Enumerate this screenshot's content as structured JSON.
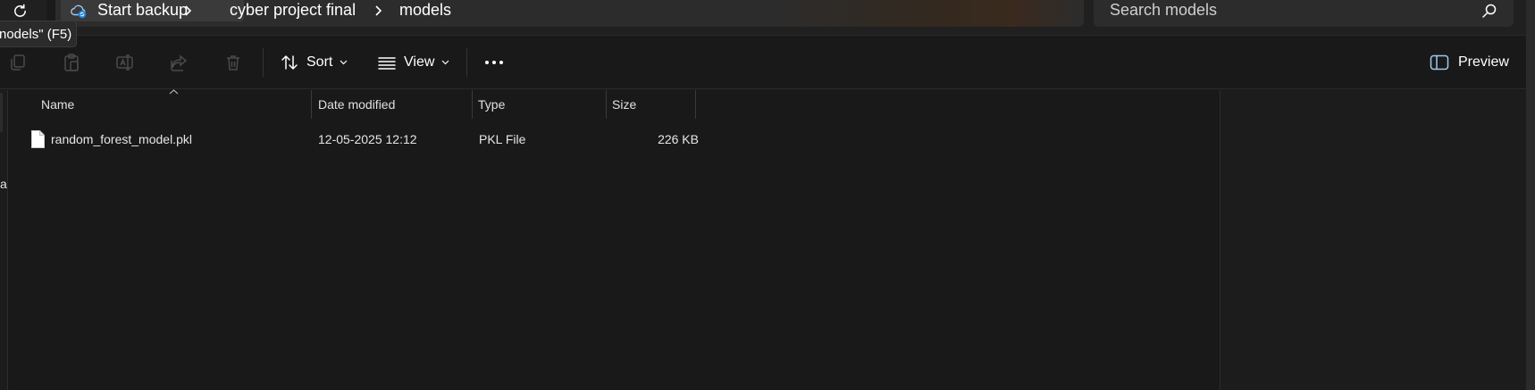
{
  "address_bar": {
    "breadcrumbs": [
      {
        "label": "Start backup"
      },
      {
        "label": "cyber project final"
      },
      {
        "label": "models"
      }
    ],
    "search_placeholder": "Search models"
  },
  "tooltip": {
    "text": "nodels\" (F5)"
  },
  "command_bar": {
    "sort_label": "Sort",
    "view_label": "View",
    "preview_label": "Preview"
  },
  "nav_pane": {
    "clipped_text": "a"
  },
  "file_list": {
    "columns": [
      {
        "label": "Name"
      },
      {
        "label": "Date modified"
      },
      {
        "label": "Type"
      },
      {
        "label": "Size"
      }
    ],
    "sorted_by": "Name",
    "rows": [
      {
        "name": "random_forest_model.pkl",
        "date_modified": "12-05-2025 12:12",
        "type": "PKL File",
        "size": "226 KB"
      }
    ]
  },
  "colors": {
    "background": "#191919",
    "accent_blue": "#60cdff"
  },
  "icons": [
    "refresh-icon",
    "cloud-sync-icon",
    "chevron-right-icon",
    "search-icon",
    "copy-icon",
    "paste-icon",
    "rename-icon",
    "share-icon",
    "delete-icon",
    "sort-icon",
    "view-icon",
    "more-icon",
    "preview-pane-icon",
    "file-icon"
  ]
}
